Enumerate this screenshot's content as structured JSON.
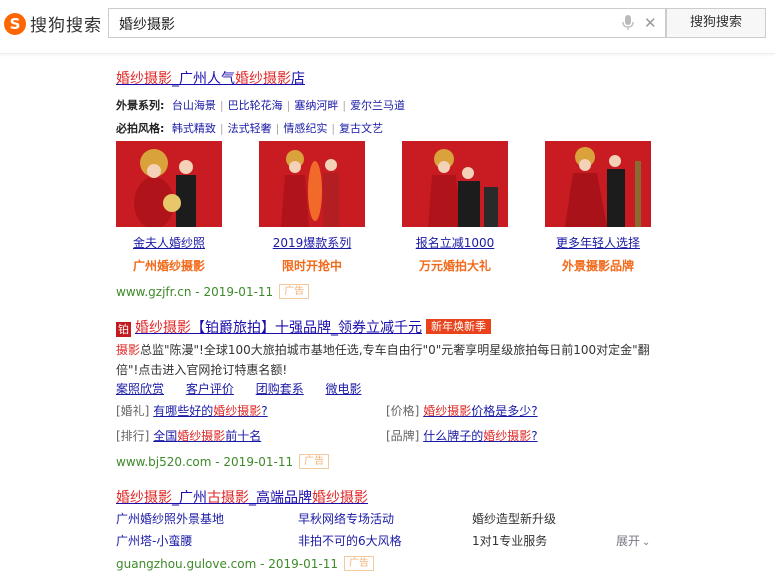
{
  "header": {
    "logo_mark": "S",
    "logo_text": "搜狗搜索",
    "query": "婚纱摄影",
    "search_button": "搜狗搜索"
  },
  "result1": {
    "title_hl1": "婚纱摄影",
    "title_mid": "_广州人气",
    "title_hl2": "婚纱摄影",
    "title_end": "店",
    "row1_label": "外景系列:",
    "row1_links": [
      "台山海景",
      "巴比轮花海",
      "塞纳河畔",
      "爱尔兰马道"
    ],
    "row2_label": "必拍风格:",
    "row2_links": [
      "韩式精致",
      "法式轻奢",
      "情感纪实",
      "复古文艺"
    ],
    "photos": [
      {
        "caption": "金夫人婚纱照",
        "sub": "广州婚纱摄影"
      },
      {
        "caption": "2019爆款系列",
        "sub": "限时开抢中"
      },
      {
        "caption": "报名立减1000",
        "sub": "万元婚拍大礼"
      },
      {
        "caption": "更多年轻人选择",
        "sub": "外景摄影品牌"
      }
    ],
    "url": "www.gzjfr.cn - 2019-01-11",
    "ad": "广告"
  },
  "result2": {
    "badge_logo": "铂",
    "title_hl": "婚纱摄影",
    "title_rest": "【铂爵旅拍】十强品牌_领券立减千元",
    "tag": "新年焕新季",
    "desc_hl": "摄影",
    "desc_rest": "总监\"陈漫\"!全球100大旅拍城市基地任选,专车自由行\"0\"元奢享明星级旅拍每日前100对定金\"翻倍\"!点击进入官网抢订特惠名额!",
    "links": [
      "案照欣赏",
      "客户评价",
      "团购套系",
      "微电影"
    ],
    "qa": [
      {
        "tag": "[婚礼]",
        "pre": "有哪些好的",
        "hl": "婚纱摄影",
        "post": "?"
      },
      {
        "tag": "[价格]",
        "pre": "",
        "hl": "婚纱摄影",
        "post": "价格是多少?"
      },
      {
        "tag": "[排行]",
        "pre": "全国",
        "hl": "婚纱摄影",
        "post": "前十名"
      },
      {
        "tag": "[品牌]",
        "pre": "什么牌子的",
        "hl": "婚纱摄影",
        "post": "?"
      }
    ],
    "url": "www.bj520.com - 2019-01-11",
    "ad": "广告"
  },
  "result3": {
    "title_hl1": "婚纱摄影",
    "title_mid1": "_广州",
    "title_hl2": "古摄影",
    "title_mid2": "_高端品牌",
    "title_hl3": "婚纱摄影",
    "links_row1": [
      "广州婚纱照外景基地",
      "早秋网络专场活动",
      "婚纱造型新升级"
    ],
    "links_row2": [
      "广州塔-小蛮腰",
      "非拍不可的6大风格",
      "1对1专业服务"
    ],
    "expand": "展开",
    "url": "guangzhou.gulove.com - 2019-01-11",
    "ad": "广告"
  },
  "colors": {
    "accent": "#ff6600",
    "highlight": "#e02828",
    "link": "#1a1aa6",
    "url_green": "#3e8a2a"
  }
}
